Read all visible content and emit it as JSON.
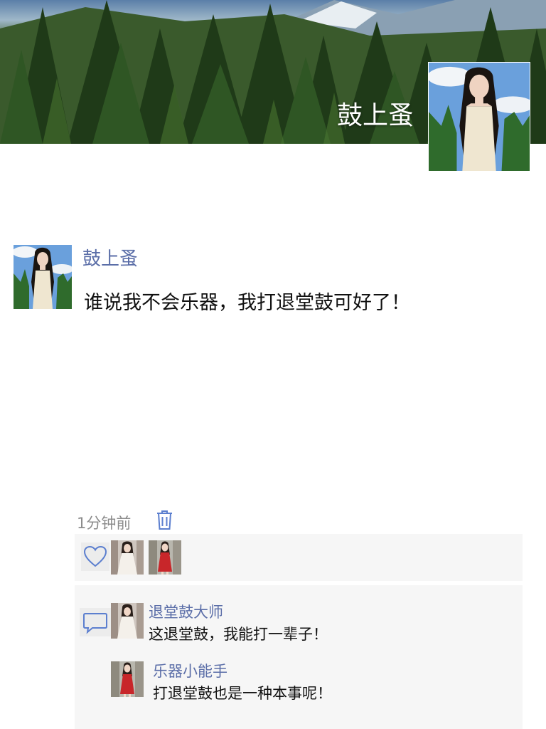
{
  "header": {
    "cover_name": "鼓上蚤"
  },
  "post": {
    "author": "鼓上蚤",
    "text": "谁说我不会乐器，我打退堂鼓可好了！",
    "time": "1分钟前"
  },
  "likes": {
    "users": [
      "white-dress-girl",
      "red-dress-girl"
    ]
  },
  "comments": [
    {
      "author": "退堂鼓大师",
      "text": "这退堂鼓，我能打一辈子！"
    },
    {
      "author": "乐器小能手",
      "text": "打退堂鼓也是一种本事呢！"
    }
  ],
  "icons": {
    "like": "heart-outline-icon",
    "comment": "speech-bubble-icon",
    "delete": "trash-icon"
  },
  "colors": {
    "name_link": "#5b6ea8",
    "icon_blue": "#5c7fcf",
    "panel_bg": "#f6f6f6",
    "muted_text": "#8c8c8c"
  }
}
